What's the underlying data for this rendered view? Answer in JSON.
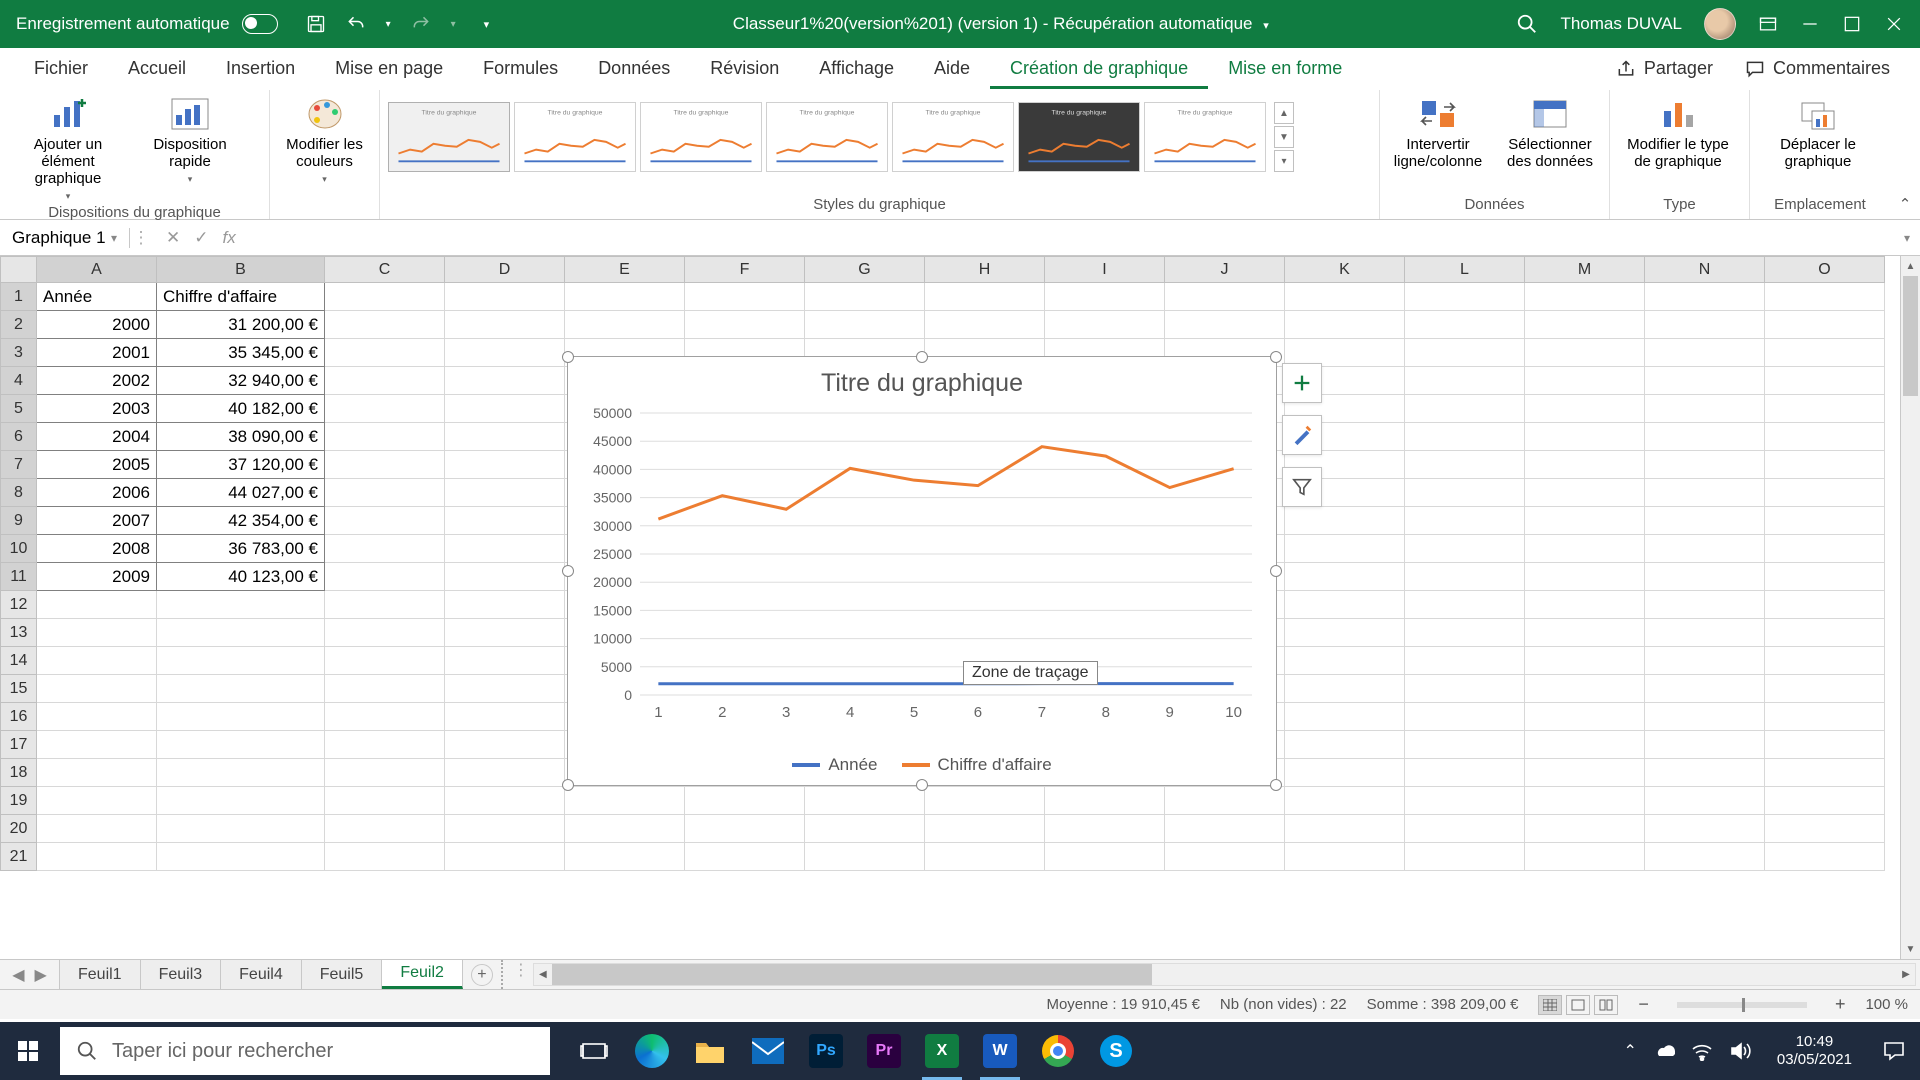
{
  "titlebar": {
    "autosave": "Enregistrement automatique",
    "doc": "Classeur1%20(version%201) (version 1)  -  Récupération automatique",
    "user": "Thomas DUVAL"
  },
  "ribbon_tabs": {
    "file": "Fichier",
    "home": "Accueil",
    "insert": "Insertion",
    "layout": "Mise en page",
    "formulas": "Formules",
    "data": "Données",
    "review": "Révision",
    "view": "Affichage",
    "help": "Aide",
    "chart_design": "Création de graphique",
    "format": "Mise en forme",
    "share": "Partager",
    "comments": "Commentaires"
  },
  "ribbon": {
    "add_element": "Ajouter un élément graphique",
    "quick_layout": "Disposition rapide",
    "change_colors": "Modifier les couleurs",
    "group_layouts": "Dispositions du graphique",
    "group_styles": "Styles du graphique",
    "switch_rowcol": "Intervertir ligne/colonne",
    "select_data": "Sélectionner des données",
    "group_data": "Données",
    "change_type": "Modifier le type de graphique",
    "group_type": "Type",
    "move_chart": "Déplacer le graphique",
    "group_location": "Emplacement"
  },
  "namebox": "Graphique 1",
  "columns": [
    "A",
    "B",
    "C",
    "D",
    "E",
    "F",
    "G",
    "H",
    "I",
    "J",
    "K",
    "L",
    "M",
    "N",
    "O"
  ],
  "rows": [
    1,
    2,
    3,
    4,
    5,
    6,
    7,
    8,
    9,
    10,
    11,
    12,
    13,
    14,
    15,
    16,
    17,
    18,
    19,
    20,
    21
  ],
  "cells": {
    "A1": "Année",
    "B1": "Chiffre d'affaire",
    "A2": "2000",
    "B2": "31 200,00 €",
    "A3": "2001",
    "B3": "35 345,00 €",
    "A4": "2002",
    "B4": "32 940,00 €",
    "A5": "2003",
    "B5": "40 182,00 €",
    "A6": "2004",
    "B6": "38 090,00 €",
    "A7": "2005",
    "B7": "37 120,00 €",
    "A8": "2006",
    "B8": "44 027,00 €",
    "A9": "2007",
    "B9": "42 354,00 €",
    "A10": "2008",
    "B10": "36 783,00 €",
    "A11": "2009",
    "B11": "40 123,00 €"
  },
  "chart": {
    "title": "Titre du graphique",
    "plot_tooltip": "Zone de traçage",
    "legend_a": "Année",
    "legend_b": "Chiffre d'affaire"
  },
  "chart_data": {
    "type": "line",
    "title": "Titre du graphique",
    "x": [
      1,
      2,
      3,
      4,
      5,
      6,
      7,
      8,
      9,
      10
    ],
    "series": [
      {
        "name": "Année",
        "values": [
          2000,
          2001,
          2002,
          2003,
          2004,
          2005,
          2006,
          2007,
          2008,
          2009
        ],
        "color": "#4472c4"
      },
      {
        "name": "Chiffre d'affaire",
        "values": [
          31200,
          35345,
          32940,
          40182,
          38090,
          37120,
          44027,
          42354,
          36783,
          40123
        ],
        "color": "#ed7d31"
      }
    ],
    "ylim": [
      0,
      50000
    ],
    "yticks": [
      0,
      5000,
      10000,
      15000,
      20000,
      25000,
      30000,
      35000,
      40000,
      45000,
      50000
    ],
    "xlabel": "",
    "ylabel": ""
  },
  "sheets": {
    "s1": "Feuil1",
    "s3": "Feuil3",
    "s4": "Feuil4",
    "s5": "Feuil5",
    "s2": "Feuil2"
  },
  "status": {
    "avg": "Moyenne : 19 910,45 €",
    "count": "Nb (non vides) : 22",
    "sum": "Somme : 398 209,00 €",
    "zoom": "100 %"
  },
  "taskbar": {
    "search_placeholder": "Taper ici pour rechercher",
    "time": "10:49",
    "date": "03/05/2021"
  }
}
